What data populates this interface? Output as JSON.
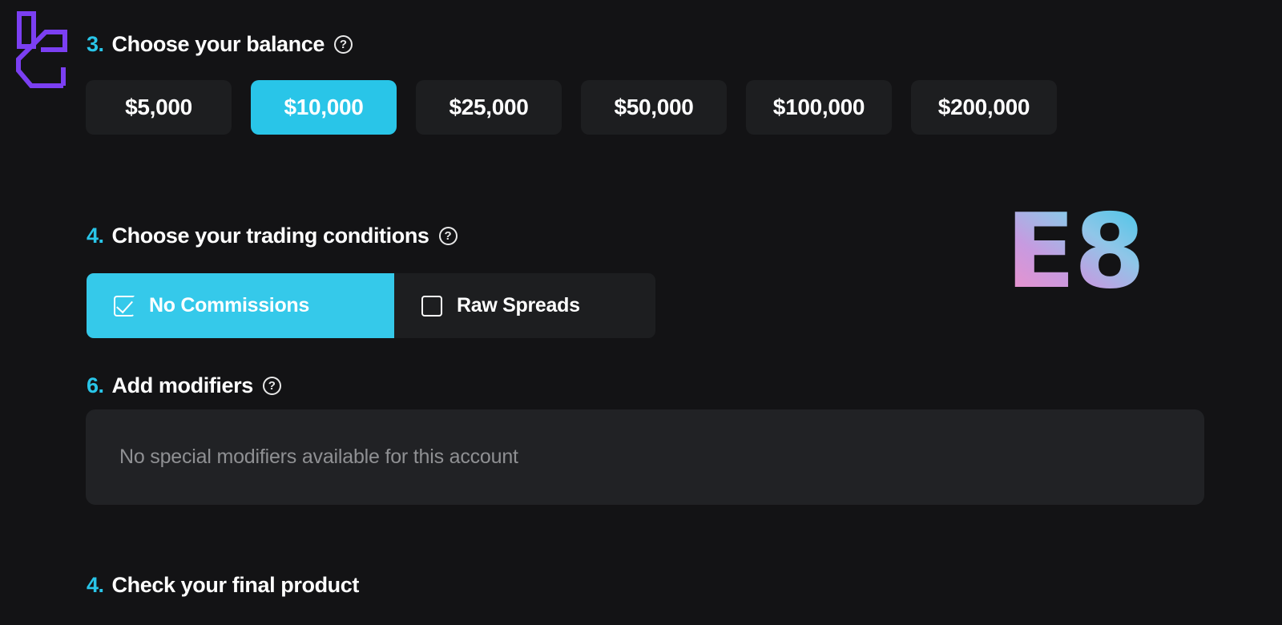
{
  "brand": {
    "mark_name": "purple-angular-logo-mark",
    "mark_color": "#7B3FF2",
    "wordmark": "E8",
    "wordmark_gradient_from": "#f58fc6",
    "wordmark_gradient_to": "#31c6e8"
  },
  "theme": {
    "background": "#131315",
    "accent": "#29c5e8",
    "surface": "#1d1e20",
    "panel": "#212225",
    "muted_text": "#8f9093"
  },
  "sections": {
    "balance": {
      "step": "3.",
      "title": "Choose your balance",
      "help": "?",
      "options": [
        {
          "label": "$5,000",
          "selected": false
        },
        {
          "label": "$10,000",
          "selected": true
        },
        {
          "label": "$25,000",
          "selected": false
        },
        {
          "label": "$50,000",
          "selected": false
        },
        {
          "label": "$100,000",
          "selected": false
        },
        {
          "label": "$200,000",
          "selected": false
        }
      ],
      "selected_value": "$10,000"
    },
    "trading_conditions": {
      "step": "4.",
      "title": "Choose your trading conditions",
      "help": "?",
      "options": [
        {
          "label": "No Commissions",
          "checked": true,
          "checkbox": "checkbox-checked-icon"
        },
        {
          "label": "Raw Spreads",
          "checked": false,
          "checkbox": "checkbox-empty-icon"
        }
      ],
      "selected_value": "No Commissions"
    },
    "modifiers": {
      "step": "6.",
      "title": "Add modifiers",
      "help": "?",
      "empty_message": "No special modifiers available for this account"
    },
    "final_product": {
      "step": "4.",
      "title": "Check your final product"
    }
  }
}
